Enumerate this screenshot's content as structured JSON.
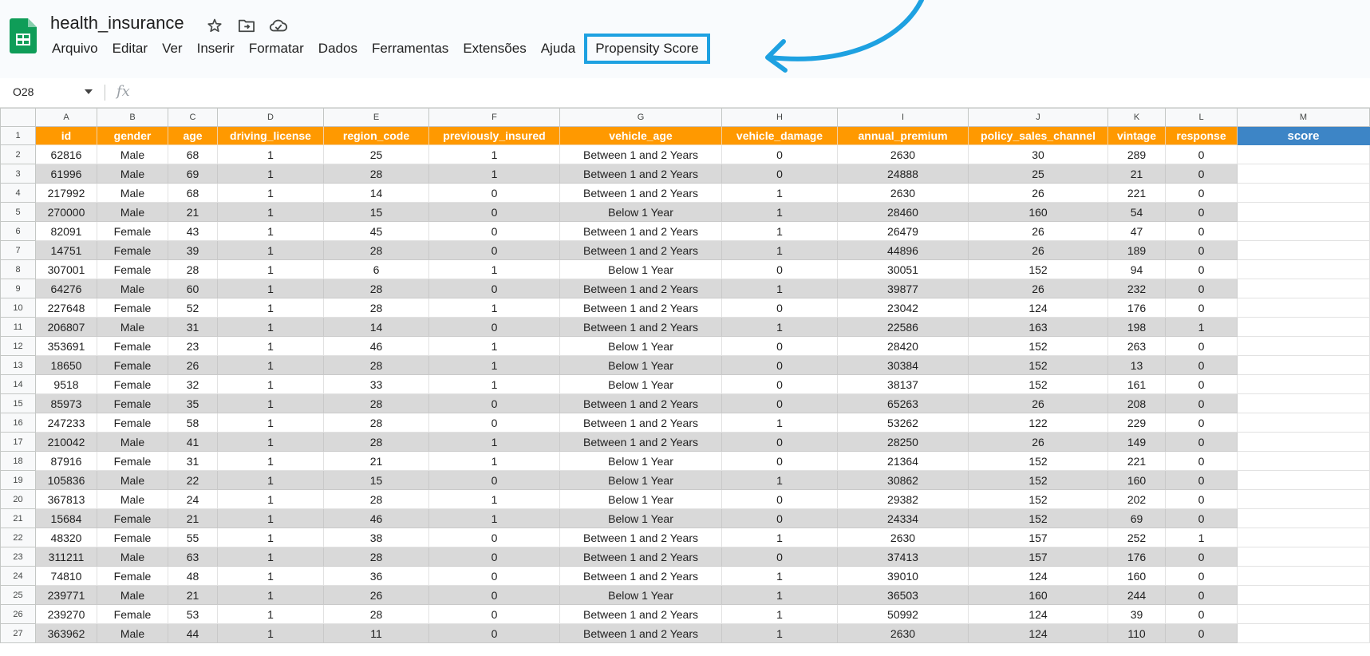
{
  "doc": {
    "title": "health_insurance"
  },
  "colors": {
    "header_orange": "#ff9900",
    "score_blue": "#3d85c6",
    "accent_cyan": "#1ea1e1",
    "sheets_green": "#0f9d58"
  },
  "icons": [
    "google-sheets-logo-icon",
    "star-icon",
    "move-to-folder-icon",
    "cloud-saved-icon",
    "dropdown-caret-icon",
    "fx-icon",
    "curved-arrow-icon"
  ],
  "menu": [
    "Arquivo",
    "Editar",
    "Ver",
    "Inserir",
    "Formatar",
    "Dados",
    "Ferramentas",
    "Extensões",
    "Ajuda",
    "Propensity Score"
  ],
  "formula_bar": {
    "cell_ref": "O28",
    "fx": "fx"
  },
  "sheet": {
    "col_letters": [
      "A",
      "B",
      "C",
      "D",
      "E",
      "F",
      "G",
      "H",
      "I",
      "J",
      "K",
      "L",
      "M"
    ],
    "headers": [
      "id",
      "gender",
      "age",
      "driving_license",
      "region_code",
      "previously_insured",
      "vehicle_age",
      "vehicle_damage",
      "annual_premium",
      "policy_sales_channel",
      "vintage",
      "response",
      "score"
    ],
    "rows": [
      [
        "62816",
        "Male",
        "68",
        "1",
        "25",
        "1",
        "Between 1 and 2 Years",
        "0",
        "2630",
        "30",
        "289",
        "0",
        ""
      ],
      [
        "61996",
        "Male",
        "69",
        "1",
        "28",
        "1",
        "Between 1 and 2 Years",
        "0",
        "24888",
        "25",
        "21",
        "0",
        ""
      ],
      [
        "217992",
        "Male",
        "68",
        "1",
        "14",
        "0",
        "Between 1 and 2 Years",
        "1",
        "2630",
        "26",
        "221",
        "0",
        ""
      ],
      [
        "270000",
        "Male",
        "21",
        "1",
        "15",
        "0",
        "Below 1 Year",
        "1",
        "28460",
        "160",
        "54",
        "0",
        ""
      ],
      [
        "82091",
        "Female",
        "43",
        "1",
        "45",
        "0",
        "Between 1 and 2 Years",
        "1",
        "26479",
        "26",
        "47",
        "0",
        ""
      ],
      [
        "14751",
        "Female",
        "39",
        "1",
        "28",
        "0",
        "Between 1 and 2 Years",
        "1",
        "44896",
        "26",
        "189",
        "0",
        ""
      ],
      [
        "307001",
        "Female",
        "28",
        "1",
        "6",
        "1",
        "Below 1 Year",
        "0",
        "30051",
        "152",
        "94",
        "0",
        ""
      ],
      [
        "64276",
        "Male",
        "60",
        "1",
        "28",
        "0",
        "Between 1 and 2 Years",
        "1",
        "39877",
        "26",
        "232",
        "0",
        ""
      ],
      [
        "227648",
        "Female",
        "52",
        "1",
        "28",
        "1",
        "Between 1 and 2 Years",
        "0",
        "23042",
        "124",
        "176",
        "0",
        ""
      ],
      [
        "206807",
        "Male",
        "31",
        "1",
        "14",
        "0",
        "Between 1 and 2 Years",
        "1",
        "22586",
        "163",
        "198",
        "1",
        ""
      ],
      [
        "353691",
        "Female",
        "23",
        "1",
        "46",
        "1",
        "Below 1 Year",
        "0",
        "28420",
        "152",
        "263",
        "0",
        ""
      ],
      [
        "18650",
        "Female",
        "26",
        "1",
        "28",
        "1",
        "Below 1 Year",
        "0",
        "30384",
        "152",
        "13",
        "0",
        ""
      ],
      [
        "9518",
        "Female",
        "32",
        "1",
        "33",
        "1",
        "Below 1 Year",
        "0",
        "38137",
        "152",
        "161",
        "0",
        ""
      ],
      [
        "85973",
        "Female",
        "35",
        "1",
        "28",
        "0",
        "Between 1 and 2 Years",
        "0",
        "65263",
        "26",
        "208",
        "0",
        ""
      ],
      [
        "247233",
        "Female",
        "58",
        "1",
        "28",
        "0",
        "Between 1 and 2 Years",
        "1",
        "53262",
        "122",
        "229",
        "0",
        ""
      ],
      [
        "210042",
        "Male",
        "41",
        "1",
        "28",
        "1",
        "Between 1 and 2 Years",
        "0",
        "28250",
        "26",
        "149",
        "0",
        ""
      ],
      [
        "87916",
        "Female",
        "31",
        "1",
        "21",
        "1",
        "Below 1 Year",
        "0",
        "21364",
        "152",
        "221",
        "0",
        ""
      ],
      [
        "105836",
        "Male",
        "22",
        "1",
        "15",
        "0",
        "Below 1 Year",
        "1",
        "30862",
        "152",
        "160",
        "0",
        ""
      ],
      [
        "367813",
        "Male",
        "24",
        "1",
        "28",
        "1",
        "Below 1 Year",
        "0",
        "29382",
        "152",
        "202",
        "0",
        ""
      ],
      [
        "15684",
        "Female",
        "21",
        "1",
        "46",
        "1",
        "Below 1 Year",
        "0",
        "24334",
        "152",
        "69",
        "0",
        ""
      ],
      [
        "48320",
        "Female",
        "55",
        "1",
        "38",
        "0",
        "Between 1 and 2 Years",
        "1",
        "2630",
        "157",
        "252",
        "1",
        ""
      ],
      [
        "311211",
        "Male",
        "63",
        "1",
        "28",
        "0",
        "Between 1 and 2 Years",
        "0",
        "37413",
        "157",
        "176",
        "0",
        ""
      ],
      [
        "74810",
        "Female",
        "48",
        "1",
        "36",
        "0",
        "Between 1 and 2 Years",
        "1",
        "39010",
        "124",
        "160",
        "0",
        ""
      ],
      [
        "239771",
        "Male",
        "21",
        "1",
        "26",
        "0",
        "Below 1 Year",
        "1",
        "36503",
        "160",
        "244",
        "0",
        ""
      ],
      [
        "239270",
        "Female",
        "53",
        "1",
        "28",
        "0",
        "Between 1 and 2 Years",
        "1",
        "50992",
        "124",
        "39",
        "0",
        ""
      ],
      [
        "363962",
        "Male",
        "44",
        "1",
        "11",
        "0",
        "Between 1 and 2 Years",
        "1",
        "2630",
        "124",
        "110",
        "0",
        ""
      ]
    ]
  }
}
